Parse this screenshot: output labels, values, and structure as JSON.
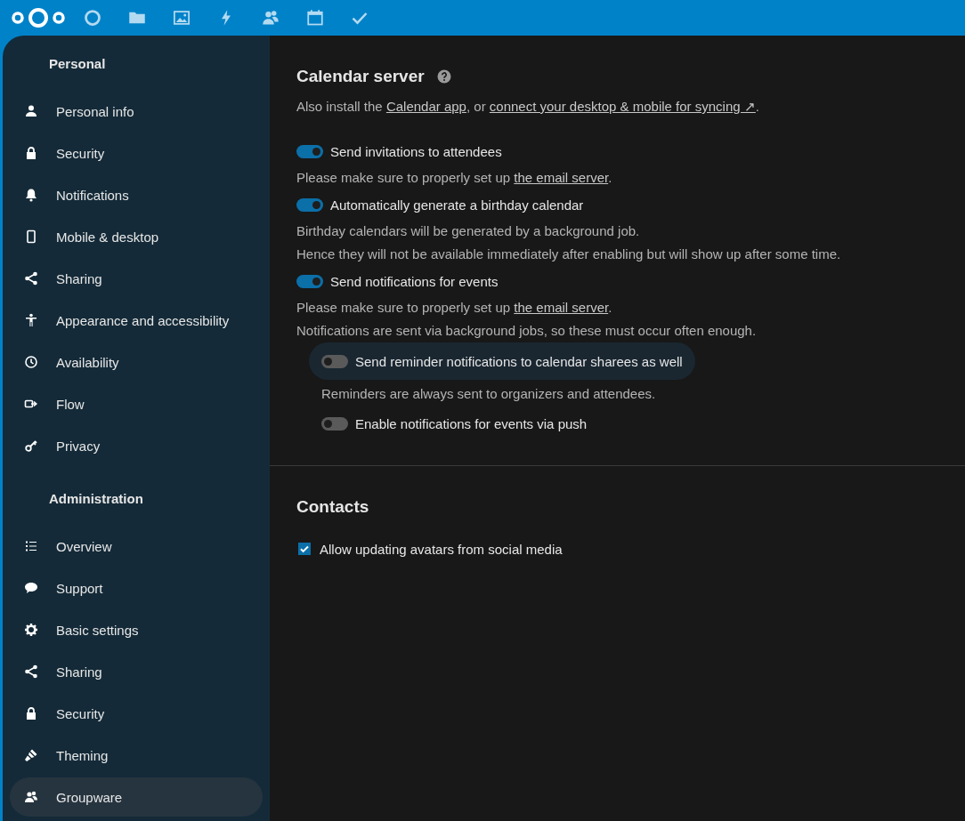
{
  "sidebar": {
    "sections": [
      {
        "title": "Personal",
        "items": [
          {
            "label": "Personal info",
            "selected": false
          },
          {
            "label": "Security",
            "selected": false
          },
          {
            "label": "Notifications",
            "selected": false
          },
          {
            "label": "Mobile & desktop",
            "selected": false
          },
          {
            "label": "Sharing",
            "selected": false
          },
          {
            "label": "Appearance and accessibility",
            "selected": false
          },
          {
            "label": "Availability",
            "selected": false
          },
          {
            "label": "Flow",
            "selected": false
          },
          {
            "label": "Privacy",
            "selected": false
          }
        ]
      },
      {
        "title": "Administration",
        "items": [
          {
            "label": "Overview",
            "selected": false
          },
          {
            "label": "Support",
            "selected": false
          },
          {
            "label": "Basic settings",
            "selected": false
          },
          {
            "label": "Sharing",
            "selected": false
          },
          {
            "label": "Security",
            "selected": false
          },
          {
            "label": "Theming",
            "selected": false
          },
          {
            "label": "Groupware",
            "selected": true
          }
        ]
      }
    ]
  },
  "sections": [
    {
      "title": "Calendar server",
      "help": true,
      "intro": [
        {
          "kind": "text",
          "text": "Also install the "
        },
        {
          "kind": "link",
          "text": "Calendar app"
        },
        {
          "kind": "text",
          "text": ", or "
        },
        {
          "kind": "link",
          "text": "connect your desktop & mobile for syncing ↗"
        },
        {
          "kind": "text",
          "text": "."
        }
      ],
      "options": [
        {
          "kind": "toggle",
          "label": "Send invitations to attendees",
          "on": true,
          "hovered": false
        },
        {
          "kind": "note",
          "parts": [
            {
              "kind": "text",
              "text": "Please make sure to properly set up "
            },
            {
              "kind": "link",
              "text": "the email server"
            },
            {
              "kind": "text",
              "text": "."
            }
          ]
        },
        {
          "kind": "toggle",
          "label": "Automatically generate a birthday calendar",
          "on": true,
          "hovered": false
        },
        {
          "kind": "note",
          "parts": [
            {
              "kind": "text",
              "text": "Birthday calendars will be generated by a background job."
            }
          ]
        },
        {
          "kind": "note",
          "parts": [
            {
              "kind": "text",
              "text": "Hence they will not be available immediately after enabling but will show up after some time."
            }
          ]
        },
        {
          "kind": "toggle",
          "label": "Send notifications for events",
          "on": true,
          "hovered": false
        },
        {
          "kind": "note",
          "parts": [
            {
              "kind": "text",
              "text": "Please make sure to properly set up "
            },
            {
              "kind": "link",
              "text": "the email server"
            },
            {
              "kind": "text",
              "text": "."
            }
          ]
        },
        {
          "kind": "note",
          "parts": [
            {
              "kind": "text",
              "text": "Notifications are sent via background jobs, so these must occur often enough."
            }
          ],
          "children": [
            {
              "kind": "toggle",
              "label": "Send reminder notifications to calendar sharees as well",
              "on": false,
              "hovered": true
            },
            {
              "kind": "note",
              "parts": [
                {
                  "kind": "text",
                  "text": "Reminders are always sent to organizers and attendees."
                }
              ]
            },
            {
              "kind": "toggle",
              "label": "Enable notifications for events via push",
              "on": false,
              "hovered": false
            }
          ]
        }
      ]
    },
    {
      "title": "Contacts",
      "help": false,
      "options": [
        {
          "kind": "checkbox",
          "label": "Allow updating avatars from social media",
          "on": true,
          "hovered": false
        }
      ]
    }
  ]
}
